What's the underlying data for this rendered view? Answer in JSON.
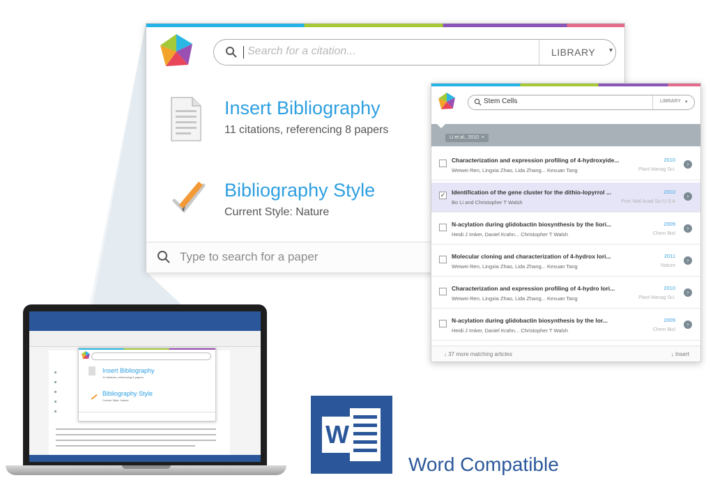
{
  "main_popup": {
    "search_placeholder": "Search for a citation...",
    "library_label": "LIBRARY",
    "insert_bibliography": {
      "title": "Insert Bibliography",
      "subtitle": "11 citations, referencing 8 papers"
    },
    "bibliography_style": {
      "title": "Bibliography Style",
      "subtitle": "Current Style: Nature"
    },
    "footer_placeholder": "Type to search for a paper"
  },
  "results_popup": {
    "search_value": "Stem Cells",
    "library_label": "LIBRARY",
    "filter_chip": "Li et al., 2010",
    "results": [
      {
        "title": "Characterization and expression profiling of 4-hydroxyide...",
        "year": "2010",
        "authors": "Weiwei Ren, Lingxia Zhao, Lida Zhang... Kexuan Tang",
        "journal": "Plant Manag Sci.",
        "checked": false
      },
      {
        "title": "Identification of the gene cluster for the dithio-lopyrrol ...",
        "year": "2010",
        "authors": "Bo Li and Christopher T Walsh",
        "journal": "Proc Natl Acad Sci U S A",
        "checked": true
      },
      {
        "title": "N-acylation during glidobactin biosynthesis by the liori...",
        "year": "2009",
        "authors": "Heidi J Imker, Daniel Krahn... Christopher T Walsh",
        "journal": "Chem Biol",
        "checked": false
      },
      {
        "title": "Molecular cloning and characterization of 4-hydrox lori...",
        "year": "2011",
        "authors": "Weiwei Ren, Lingxia Zhao, Lida Zhang... Kexuan Tang",
        "journal": "Nature",
        "checked": false
      },
      {
        "title": "Characterization and expression profiling of 4-hydro lori...",
        "year": "2010",
        "authors": "Weiwei Ren, Lingxia Zhao, Lida Zhang... Kexuan Tang",
        "journal": "Plant Manag Sci.",
        "checked": false
      },
      {
        "title": "N-acylation during glidobactin biosynthesis by the lor...",
        "year": "2009",
        "authors": "Heidi J Imker, Daniel Krahn... Christopher T Walsh",
        "journal": "Chem Biol",
        "checked": false
      }
    ],
    "footer_more": "37 more matching articles",
    "footer_insert": "Insert"
  },
  "laptop_popup": {
    "insert_title": "Insert Bibliography",
    "style_title": "Bibliography Style"
  },
  "word": {
    "logo_letter": "W",
    "caption": "Word Compatible"
  },
  "colors": {
    "accent_blue": "#2e9fe0",
    "word_blue": "#2b579a",
    "bar_blue": "#24b3e6",
    "bar_green": "#a8c935",
    "bar_purple": "#8a56b6",
    "bar_pink": "#e36b8c",
    "selected_row": "#e5e5f7"
  }
}
